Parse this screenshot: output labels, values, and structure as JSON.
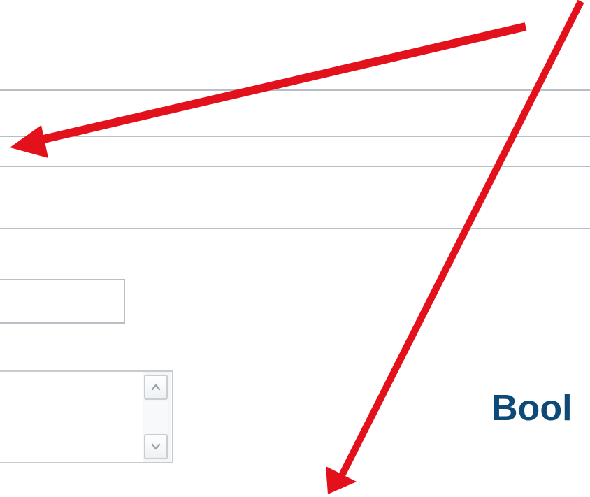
{
  "page": {
    "heading_partial": "Bool"
  },
  "form": {
    "text_input": {
      "value": "",
      "placeholder": ""
    },
    "textarea": {
      "value": ""
    }
  },
  "icons": {
    "scroll_up": "chevron-up-icon",
    "scroll_down": "chevron-down-icon"
  },
  "colors": {
    "annotation_arrow": "#e3111c",
    "heading": "#0e4a78",
    "divider": "#b8bec4",
    "input_border": "#b9bec4"
  }
}
